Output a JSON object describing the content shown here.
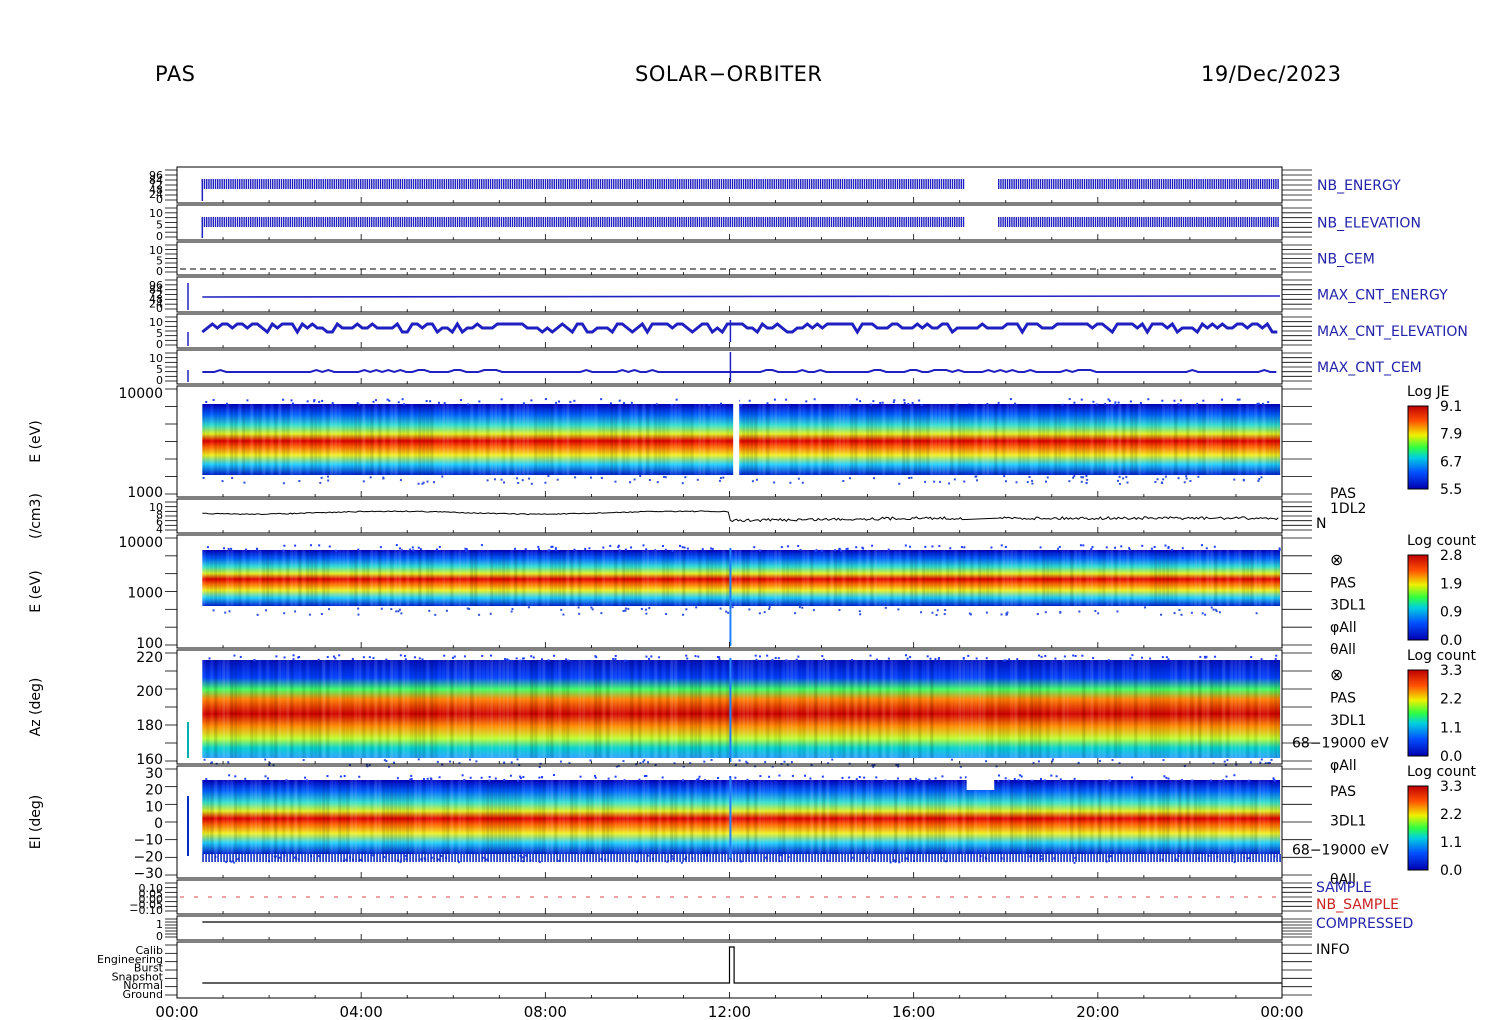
{
  "header": {
    "left": "PAS",
    "center": "SOLAR−ORBITER",
    "right": "19/Dec/2023"
  },
  "chart_data": {
    "type": "heatmap",
    "x_axis": {
      "ticks": [
        "00:00",
        "04:00",
        "08:00",
        "12:00",
        "16:00",
        "20:00",
        "00:00"
      ],
      "range_hours": [
        0,
        24
      ]
    },
    "panels": [
      {
        "id": "nb-energy",
        "type": "line",
        "label": "NB_ENERGY",
        "label_color": "#2222aa",
        "yticks": [
          "96",
          "84",
          "72",
          "48",
          "24",
          "0"
        ],
        "pattern": "dense-blue",
        "gap_hours": [
          17.1,
          17.8
        ],
        "feature_hour": 12.0
      },
      {
        "id": "nb-elevation",
        "type": "line",
        "label": "NB_ELEVATION",
        "label_color": "#2222aa",
        "yticks": [
          "10",
          "5",
          "0"
        ],
        "pattern": "dense-blue",
        "gap_hours": [
          17.1,
          17.8
        ]
      },
      {
        "id": "nb-cem",
        "type": "line",
        "label": "NB_CEM",
        "label_color": "#2222aa",
        "yticks": [
          "10",
          "5",
          "0"
        ],
        "pattern": "dashed-zero"
      },
      {
        "id": "max-cnt-energy",
        "type": "line",
        "label": "MAX_CNT_ENERGY",
        "label_color": "#2222aa",
        "yticks": [
          "96",
          "84",
          "72",
          "48",
          "24",
          "0"
        ],
        "pattern": "flat-blue"
      },
      {
        "id": "max-cnt-elevation",
        "type": "line",
        "label": "MAX_CNT_ELEVATION",
        "label_color": "#2222aa",
        "yticks": [
          "10",
          "5",
          "0"
        ],
        "pattern": "step-blue"
      },
      {
        "id": "max-cnt-cem",
        "type": "line",
        "label": "MAX_CNT_CEM",
        "label_color": "#2222aa",
        "yticks": [
          "10",
          "5",
          "0"
        ],
        "pattern": "low-blue"
      },
      {
        "id": "energy-je",
        "type": "spectrogram",
        "ylabel": "E (eV)",
        "yticks": [
          "10000",
          "1000"
        ],
        "colorbar": {
          "title": "Log JE",
          "ticks": [
            "9.1",
            "7.9",
            "6.7",
            "5.5"
          ]
        },
        "peak_log_ev": 3.25,
        "gap_hours": [
          17.1,
          17.8
        ]
      },
      {
        "id": "density",
        "type": "line",
        "ylabel": "(/cm3)",
        "yticks": [
          "10",
          "8",
          "6",
          "4"
        ],
        "side_label": [
          "PAS",
          "1DL2",
          "N"
        ],
        "values_start": 7.5,
        "values_end": 6.0
      },
      {
        "id": "energy-count",
        "type": "spectrogram",
        "ylabel": "E (eV)",
        "yticks": [
          "10000",
          "1000",
          "100"
        ],
        "colorbar": {
          "title": "Log count",
          "ticks": [
            "2.8",
            "1.9",
            "0.9",
            "0.0"
          ]
        },
        "side_label": [
          "⊗",
          "PAS",
          "3DL1",
          "φAll",
          "θAll"
        ],
        "peak_log_ev": 3.25
      },
      {
        "id": "azimuth",
        "type": "spectrogram",
        "ylabel": "Az (deg)",
        "yticks": [
          "220",
          "200",
          "180",
          "160"
        ],
        "colorbar": {
          "title": "Log count",
          "ticks": [
            "3.3",
            "2.2",
            "1.1",
            "0.0"
          ]
        },
        "side_label": [
          "⊗",
          "PAS",
          "3DL1",
          "68−19000 eV",
          "φAll"
        ],
        "peak_deg": 180
      },
      {
        "id": "elevation",
        "type": "spectrogram",
        "ylabel": "El (deg)",
        "yticks": [
          "30",
          "20",
          "10",
          "0",
          "−10",
          "−20",
          "−30"
        ],
        "colorbar": {
          "title": "Log count",
          "ticks": [
            "3.3",
            "2.2",
            "1.1",
            "0.0"
          ]
        },
        "side_label": [
          "PAS",
          "3DL1",
          "68−19000 eV",
          "θAll"
        ],
        "peak_deg": 3
      },
      {
        "id": "sample",
        "type": "line",
        "yticks": [
          "0.10",
          "0.05",
          "0.00",
          "−0.05",
          "−0.10"
        ],
        "labels": [
          {
            "text": "SAMPLE",
            "color": "#2222aa"
          },
          {
            "text": "NB_SAMPLE",
            "color": "#cc2222"
          }
        ]
      },
      {
        "id": "compressed",
        "type": "line",
        "yticks": [
          "1",
          "0"
        ],
        "labels": [
          {
            "text": "COMPRESSED",
            "color": "#2222aa"
          }
        ]
      },
      {
        "id": "info",
        "type": "line",
        "yticks": [
          "Calib",
          "Engineering",
          "Burst",
          "Snapshot",
          "Normal",
          "Ground"
        ],
        "labels": [
          {
            "text": "INFO",
            "color": "#000000"
          }
        ],
        "step_hour": 12.1
      }
    ]
  }
}
